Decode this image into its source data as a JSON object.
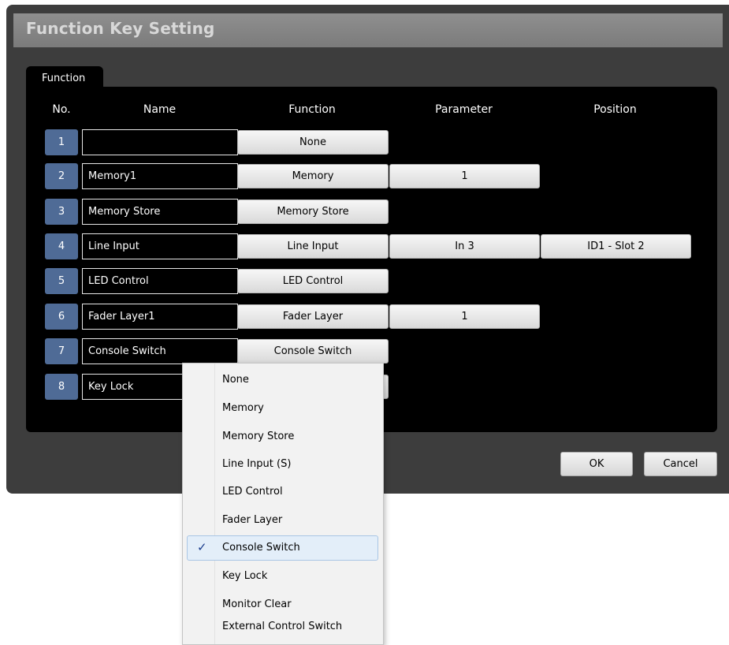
{
  "dialog": {
    "title": "Function Key Setting",
    "tab": "Function",
    "headers": {
      "no": "No.",
      "name": "Name",
      "function": "Function",
      "parameter": "Parameter",
      "position": "Position"
    },
    "rows": [
      {
        "no": "1",
        "name": "",
        "function": "None",
        "parameter": "",
        "position": ""
      },
      {
        "no": "2",
        "name": "Memory1",
        "function": "Memory",
        "parameter": "1",
        "position": ""
      },
      {
        "no": "3",
        "name": "Memory Store",
        "function": "Memory Store",
        "parameter": "",
        "position": ""
      },
      {
        "no": "4",
        "name": "Line Input",
        "function": "Line Input",
        "parameter": "In 3",
        "position": "ID1 - Slot 2"
      },
      {
        "no": "5",
        "name": "LED Control",
        "function": "LED Control",
        "parameter": "",
        "position": ""
      },
      {
        "no": "6",
        "name": "Fader Layer1",
        "function": "Fader Layer",
        "parameter": "1",
        "position": ""
      },
      {
        "no": "7",
        "name": "Console Switch",
        "function": "Console Switch",
        "parameter": "",
        "position": ""
      },
      {
        "no": "8",
        "name": "Key Lock",
        "function": "",
        "parameter": "",
        "position": ""
      }
    ],
    "ok_label": "OK",
    "cancel_label": "Cancel"
  },
  "dropdown": {
    "items": [
      {
        "label": "None",
        "selected": false
      },
      {
        "label": "Memory",
        "selected": false
      },
      {
        "label": "Memory Store",
        "selected": false
      },
      {
        "label": "Line Input (S)",
        "selected": false
      },
      {
        "label": "LED Control",
        "selected": false
      },
      {
        "label": "Fader Layer",
        "selected": false
      },
      {
        "label": "Console Switch",
        "selected": true
      },
      {
        "label": "Key Lock",
        "selected": false
      },
      {
        "label": "Monitor Clear",
        "selected": false
      },
      {
        "label": "External Control Switch",
        "selected": false
      }
    ],
    "check_glyph": "✓"
  },
  "colors": {
    "dialog_bg": "#3d3d3d",
    "panel_bg": "#000000",
    "number_badge": "#4f6b96",
    "selection": "#e3eef9"
  }
}
